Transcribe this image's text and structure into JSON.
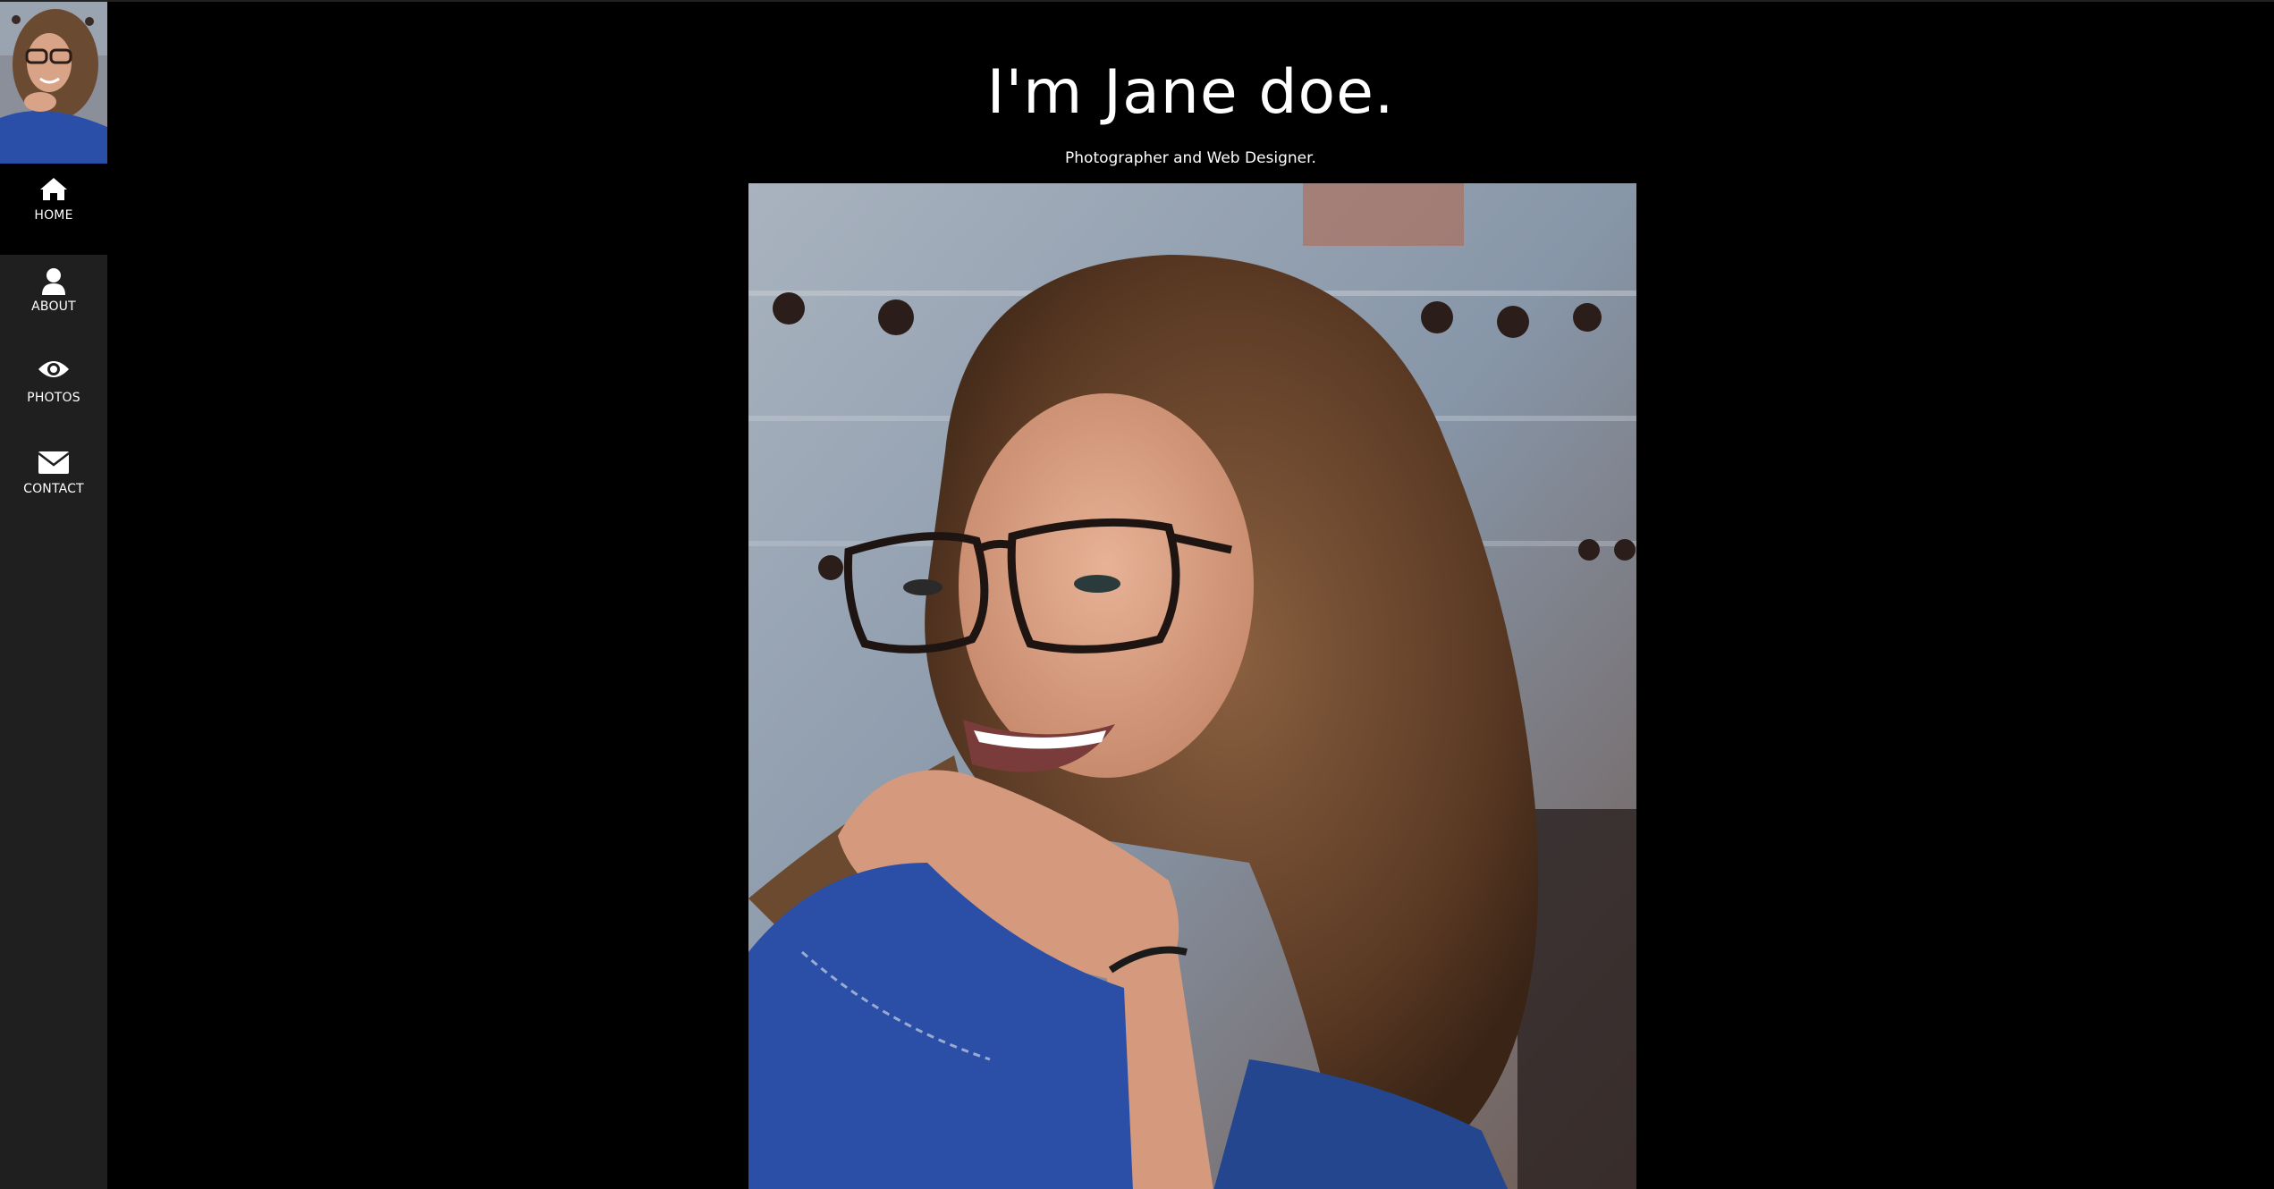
{
  "sidebar": {
    "items": [
      {
        "label": "HOME",
        "icon": "home-icon",
        "active": true
      },
      {
        "label": "ABOUT",
        "icon": "user-icon",
        "active": false
      },
      {
        "label": "PHOTOS",
        "icon": "eye-icon",
        "active": false
      },
      {
        "label": "CONTACT",
        "icon": "envelope-icon",
        "active": false
      }
    ]
  },
  "hero": {
    "title": "I'm Jane doe.",
    "subtitle": "Photographer and Web Designer."
  },
  "colors": {
    "background": "#000000",
    "sidebar": "#1f1f1f",
    "text": "#ffffff"
  }
}
